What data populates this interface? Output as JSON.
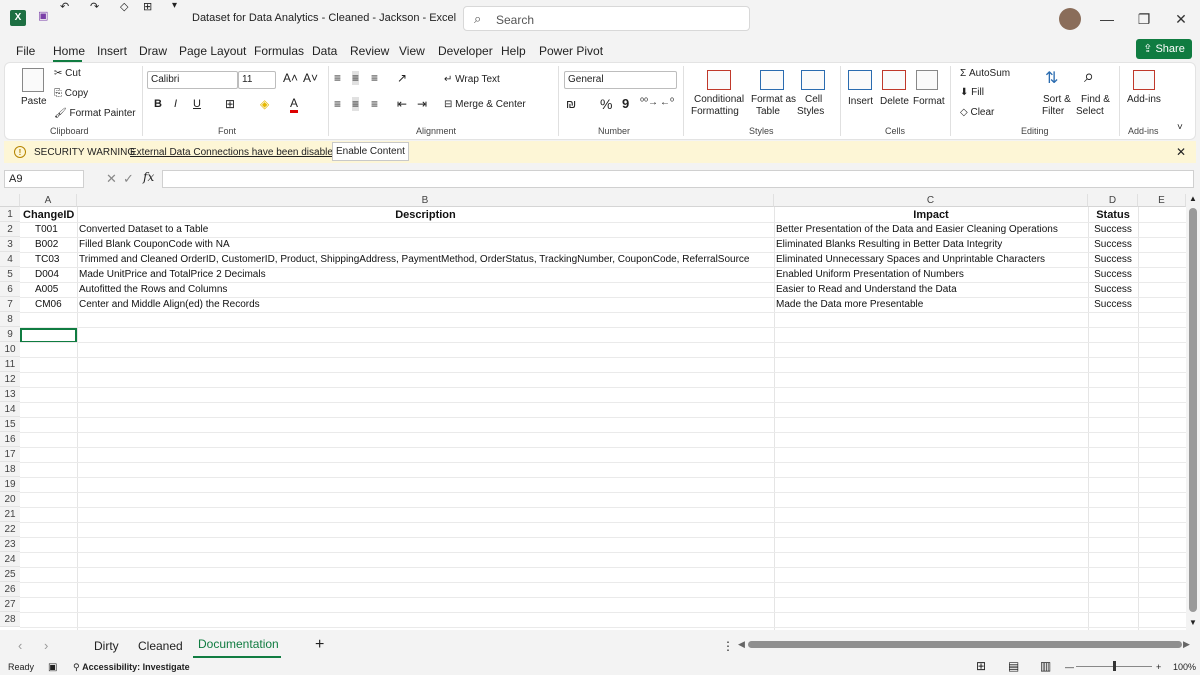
{
  "titlebar": {
    "app_icon": "X",
    "title": "Dataset for Data Analytics - Cleaned - Jackson  -  Excel",
    "search_placeholder": "Search",
    "icons": [
      "save-icon",
      "undo-icon",
      "redo-icon",
      "format-icon",
      "quick-access-icon",
      "customize-icon"
    ]
  },
  "menu": {
    "tabs": [
      "File",
      "Home",
      "Insert",
      "Draw",
      "Page Layout",
      "Formulas",
      "Data",
      "Review",
      "View",
      "Developer",
      "Help",
      "Power Pivot"
    ],
    "active": "Home",
    "share_label": "Share"
  },
  "ribbon": {
    "clipboard": {
      "paste": "Paste",
      "cut": "Cut",
      "copy": "Copy",
      "format_painter": "Format Painter",
      "group": "Clipboard"
    },
    "font": {
      "name": "Calibri",
      "size": "11",
      "bold": "B",
      "italic": "I",
      "underline": "U",
      "group": "Font"
    },
    "alignment": {
      "wrap": "Wrap Text",
      "merge": "Merge & Center",
      "group": "Alignment"
    },
    "number": {
      "format": "General",
      "percent": "%",
      "comma": "9",
      "group": "Number"
    },
    "styles": {
      "conditional": "Conditional",
      "formatting": "Formatting",
      "format_as": "Format as",
      "table": "Table",
      "cell": "Cell",
      "styles_lbl": "Styles",
      "group": "Styles"
    },
    "cells": {
      "insert": "Insert",
      "delete": "Delete",
      "format": "Format",
      "group": "Cells"
    },
    "editing": {
      "autosum": "AutoSum",
      "fill": "Fill",
      "clear": "Clear",
      "sort": "Sort &",
      "filter": "Filter",
      "find": "Find &",
      "select": "Select",
      "group": "Editing"
    },
    "addins": {
      "label": "Add-ins",
      "group": "Add-ins"
    }
  },
  "security": {
    "title": "SECURITY WARNING",
    "message": "External Data Connections have been disabled",
    "button": "Enable Content"
  },
  "formula": {
    "namebox": "A9",
    "fx": "fx",
    "value": ""
  },
  "columns": [
    "A",
    "B",
    "C",
    "D",
    "E"
  ],
  "rows": [
    "1",
    "2",
    "3",
    "4",
    "5",
    "6",
    "7",
    "8",
    "9",
    "10",
    "11",
    "12",
    "13",
    "14",
    "15",
    "16",
    "17",
    "18",
    "19",
    "20",
    "21",
    "22",
    "23",
    "24",
    "25",
    "26",
    "27",
    "28"
  ],
  "table": {
    "headers": [
      "ChangeID",
      "Description",
      "Impact",
      "Status"
    ],
    "records": [
      [
        "T001",
        "Converted Dataset to a Table",
        "Better Presentation of the Data and Easier Cleaning Operations",
        "Success"
      ],
      [
        "B002",
        "Filled Blank CouponCode with NA",
        "Eliminated Blanks Resulting in Better Data Integrity",
        "Success"
      ],
      [
        "TC03",
        "Trimmed and Cleaned OrderID, CustomerID, Product, ShippingAddress, PaymentMethod, OrderStatus, TrackingNumber, CouponCode, ReferralSource",
        "Eliminated Unnecessary Spaces and Unprintable Characters",
        "Success"
      ],
      [
        "D004",
        "Made UnitPrice and TotalPrice 2 Decimals",
        "Enabled Uniform Presentation of Numbers",
        "Success"
      ],
      [
        "A005",
        "Autofitted the Rows and Columns",
        "Easier to Read and Understand the Data",
        "Success"
      ],
      [
        "CM06",
        "Center and Middle Align(ed) the Records",
        "Made the Data more Presentable",
        "Success"
      ]
    ]
  },
  "sheets": {
    "tabs": [
      "Dirty",
      "Cleaned",
      "Documentation"
    ],
    "active": "Documentation",
    "add": "+"
  },
  "status": {
    "ready": "Ready",
    "accessibility": "Accessibility: Investigate",
    "zoom": "100%"
  }
}
